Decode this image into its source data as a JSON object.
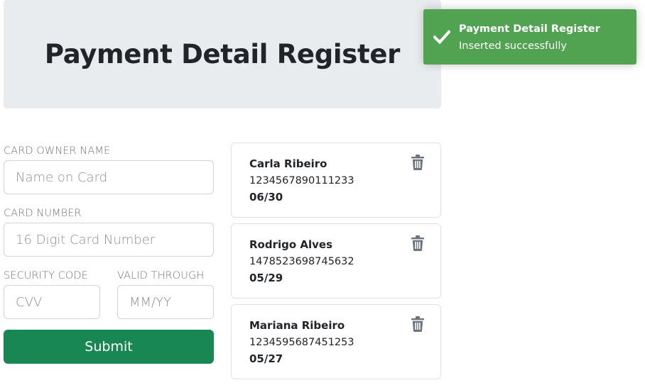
{
  "header": {
    "title": "Payment Detail Register"
  },
  "form": {
    "owner": {
      "label": "CARD OWNER NAME",
      "placeholder": "Name on Card",
      "value": ""
    },
    "number": {
      "label": "CARD NUMBER",
      "placeholder": "16 Digit Card Number",
      "value": ""
    },
    "cvv": {
      "label": "SECURITY CODE",
      "placeholder": "CVV",
      "value": ""
    },
    "expiry": {
      "label": "VALID THROUGH",
      "placeholder": "MM/YY",
      "value": ""
    },
    "submit_label": "Submit"
  },
  "cards": [
    {
      "owner": "Carla Ribeiro",
      "number": "1234567890111233",
      "expiry": "06/30"
    },
    {
      "owner": "Rodrigo Alves",
      "number": "1478523698745632",
      "expiry": "05/29"
    },
    {
      "owner": "Mariana Ribeiro",
      "number": "1234595687451253",
      "expiry": "05/27"
    }
  ],
  "toast": {
    "title": "Payment Detail Register",
    "message": "Inserted successfully",
    "icon": "check-icon"
  },
  "colors": {
    "submit": "#198754",
    "toast": "#51a351",
    "header_bg": "#e9ecef",
    "trash_icon": "#6c757d"
  },
  "icons": {
    "delete": "trash-icon"
  }
}
